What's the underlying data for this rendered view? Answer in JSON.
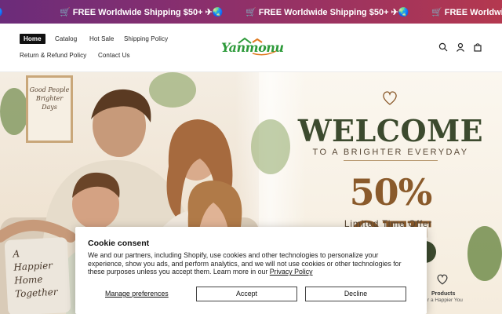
{
  "announcement": {
    "messages": [
      "🌏",
      "🛒 FREE Worldwide Shipping $50+ ✈🌏",
      "🛒 FREE Worldwide Shipping $50+ ✈🌏",
      "🛒 FREE Worldwide"
    ]
  },
  "header": {
    "nav": {
      "home": "Home",
      "catalog": "Catalog",
      "hot_sale": "Hot Sale",
      "shipping_policy": "Shipping Policy",
      "return_refund": "Return & Refund Policy",
      "contact": "Contact Us"
    },
    "logo_text": "Yanmonu",
    "icons": [
      "search-icon",
      "account-icon",
      "cart-icon"
    ]
  },
  "hero": {
    "frame_text": "Good People Brighter Days",
    "welcome": "WELCOME",
    "subtitle": "TO A BRIGHTER EVERYDAY",
    "offer": "50% OFF",
    "limited": "Limited Time Offer",
    "feature_label": "Products",
    "feature_desc": "r a Happier You",
    "pillow_text": "A Happier Home Together"
  },
  "cookie": {
    "title": "Cookie consent",
    "body": "We and our partners, including Shopify, use cookies and other technologies to personalize your experience, show you ads, and perform analytics, and we will not use cookies or other technologies for these purposes unless you accept them. Learn more in our",
    "privacy_link": "Privacy Policy",
    "manage": "Manage preferences",
    "accept": "Accept",
    "decline": "Decline"
  },
  "colors": {
    "announcement_bar": "#8a2f6d",
    "welcome_text": "#3c4a2e",
    "offer_text": "#8a5a2b",
    "logo_green": "#2d9a3a",
    "logo_orange": "#e07a20"
  }
}
